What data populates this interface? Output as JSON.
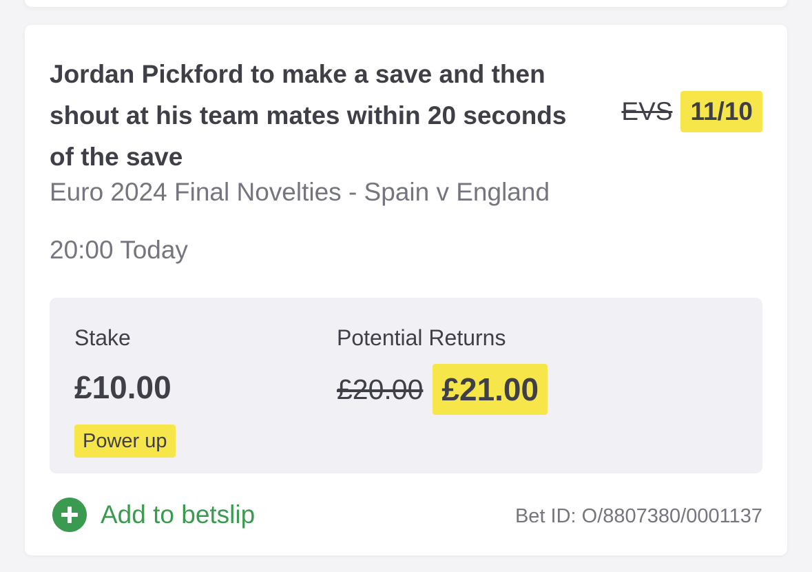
{
  "bet": {
    "title": "Jordan Pickford to make a save and then shout at his team mates within 20 seconds of the save",
    "odds_old": "EVS",
    "odds_new": "11/10",
    "event": "Euro 2024 Final Novelties - Spain v England",
    "time": "20:00 Today"
  },
  "stake": {
    "label": "Stake",
    "value": "£10.00",
    "badge": "Power up"
  },
  "returns": {
    "label": "Potential Returns",
    "old_value": "£20.00",
    "new_value": "£21.00"
  },
  "footer": {
    "add_label": "Add to betslip",
    "bet_id": "Bet ID: O/8807380/0001137"
  },
  "icons": {
    "add": "plus-circle-icon"
  },
  "colors": {
    "highlight": "#f7e64a",
    "text_dark": "#3f3f48",
    "text_muted": "#75757f",
    "panel": "#f1f1f5",
    "accent_green": "#3a9a50"
  }
}
